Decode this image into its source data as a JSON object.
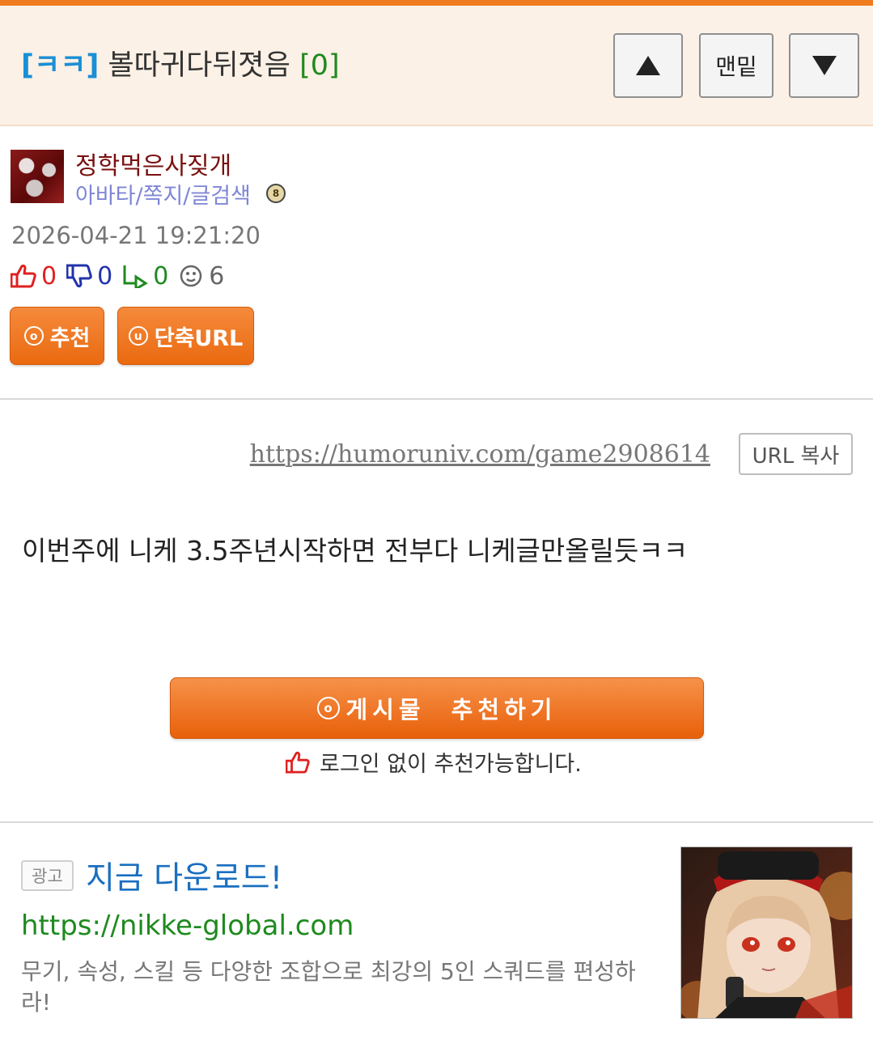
{
  "header": {
    "category": "[ㅋㅋ]",
    "title": "볼따귀다뒤졋음",
    "comment_count": "[0]",
    "up_icon": "triangle-up",
    "bottom_label": "맨밑",
    "down_icon": "triangle-down"
  },
  "author": {
    "nickname": "정학먹은사짖개",
    "links": "아바타/쪽지/글검색",
    "avatar_icon": "user-avatar",
    "badge_icon": "level-badge"
  },
  "post": {
    "date": "2026-04-21 19:21:20",
    "stats": {
      "up": "0",
      "down": "0",
      "reply": "0",
      "views": "6"
    },
    "recommend_label": "추천",
    "recommend_circle": "o",
    "short_url_label": "단축URL",
    "short_url_circle": "u",
    "url": "https://humoruniv.com/game2908614",
    "copy_label": "URL 복사",
    "content": "이번주에 니케 3.5주년시작하면 전부다 니케글만올릴듯ㅋㅋ",
    "big_recommend_label": "게시물  추천하기",
    "big_recommend_circle": "o",
    "recommend_note": "로그인 없이 추천가능합니다."
  },
  "ad": {
    "label": "광고",
    "title": "지금 다운로드!",
    "url": "https://nikke-global.com",
    "description": "무기, 속성, 스킬 등 다양한 조합으로 최강의 5인 스쿼드를 편성하라!"
  },
  "colors": {
    "accent_orange": "#f07b1e",
    "category_blue": "#1a8fd6",
    "count_green": "#1e8a1e",
    "nick_red": "#7a1010",
    "link_purple": "#7f86d6",
    "ad_title_blue": "#1a6fc0"
  }
}
